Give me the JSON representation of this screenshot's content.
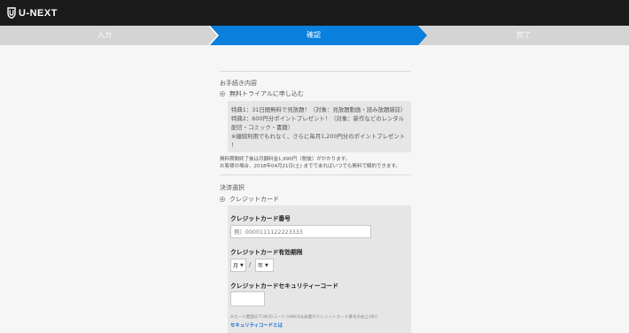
{
  "brand": {
    "name": "U-NEXT"
  },
  "steps": [
    {
      "label": "入力",
      "active": false
    },
    {
      "label": "確認",
      "active": true
    },
    {
      "label": "完了",
      "active": false
    }
  ],
  "colors": {
    "active_step": "#0a7fdc",
    "inactive_step": "#d4d4d4",
    "topbar": "#1a1a1a",
    "link": "#1a6fd0"
  },
  "procedure": {
    "title": "お手続き内容",
    "option_label": "無料トライアルに申し込む",
    "benefits": [
      "特典1：31日間無料で見放題！（対象：見放題動画・読み放題雑誌）",
      "特典2：600円分ポイントプレゼント！（対象：新作などのレンタル",
      "配信・コミック・書籍）",
      "※継続利用でもれなく、さらに毎月1,200円分のポイントプレゼント",
      "！"
    ],
    "notes": [
      "無料期間終了後は月額料金1,990円（税抜）がかかります。",
      "お客様の場合、2018年04月21日(土) までであればいつでも無料で解約できます。"
    ]
  },
  "payment": {
    "title": "決済選択",
    "option_label": "クレジットカード",
    "card_number_label": "クレジットカード番号",
    "card_number_placeholder": "例）0000111122223333",
    "expiry_label": "クレジットカード有効期限",
    "month_value": "月",
    "year_value": "年",
    "slash": "/",
    "cvc_label": "クレジットカードセキュリティーコード",
    "cvc_note": "※カード裏面の下3桁のコード [AMEXは表面のクレジットカード番号の右上4桁]",
    "cvc_link": "セキュリティコードとは"
  }
}
